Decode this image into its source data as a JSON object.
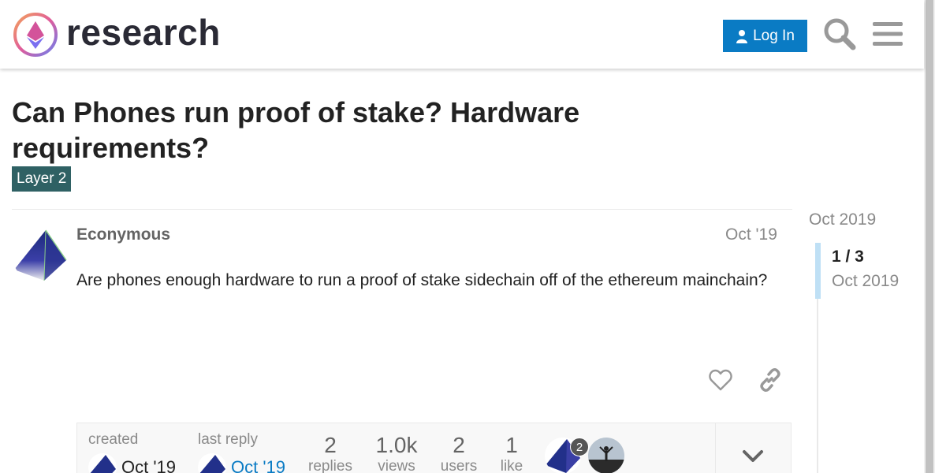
{
  "header": {
    "site_name": "research",
    "login_label": "Log In"
  },
  "topic": {
    "title": "Can Phones run proof of stake? Hardware requirements?",
    "category": "Layer 2",
    "category_color": "#2f6164"
  },
  "post": {
    "username": "Econymous",
    "date": "Oct '19",
    "body": "Are phones enough hardware to run a proof of stake sidechain off of the ethereum mainchain?"
  },
  "topic_map": {
    "created_label": "created",
    "created_date": "Oct '19",
    "last_reply_label": "last reply",
    "last_reply_date": "Oct '19",
    "stats": [
      {
        "value": "2",
        "label": "replies"
      },
      {
        "value": "1.0k",
        "label": "views"
      },
      {
        "value": "2",
        "label": "users"
      },
      {
        "value": "1",
        "label": "like"
      }
    ],
    "participant_post_count": "2"
  },
  "timeline": {
    "start_date": "Oct 2019",
    "position": "1 / 3",
    "current_date": "Oct 2019"
  },
  "colors": {
    "accent": "#0a7bc4",
    "category": "#2f6164"
  },
  "icons": [
    "logo-icon",
    "user-icon",
    "search-icon",
    "menu-icon",
    "heart-icon",
    "link-icon",
    "chevron-down-icon"
  ]
}
